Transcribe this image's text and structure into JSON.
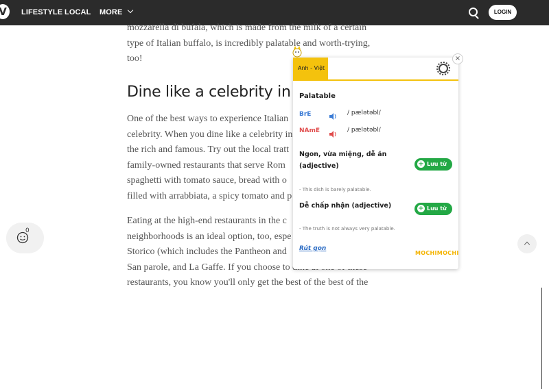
{
  "topbar": {
    "logo": "V",
    "nav": [
      "LIFESTYLE",
      "LOCAL",
      "MORE"
    ],
    "login_label": "LOGIN",
    "icons": {
      "search": "search-icon",
      "more": "chevron-down-icon"
    }
  },
  "article": {
    "p1_lines": [
      "mozzarella di bufala, which is made from the milk of a certain",
      "type of Italian buffalo, is incredibly palatable and worth-trying,",
      "too!"
    ],
    "heading": "Dine like a celebrity in I",
    "p2_lines": [
      "One of the best ways to experience Italian",
      "celebrity. When you dine like a celebrity in",
      "the rich and famous. Try out the local tratt",
      "family-owned restaurants that serve Rom",
      "spaghetti with tomato sauce, bread with o",
      "filled with arrabbiata, a spicy tomato and p"
    ],
    "p3_lines": [
      "Eating at the high-end restaurants in the c",
      "neighborhoods is an ideal option, too, espe",
      "Storico (which includes the Pantheon and",
      "San parole, and La Gaffe. If you choose to dine at one of these",
      "restaurants, you know you'll only get the best of the best of the"
    ]
  },
  "reactions": {
    "count": "0",
    "icon": "smiley-add-icon"
  },
  "dictionary": {
    "lang_tab": "Anh - Việt",
    "word": "Palatable",
    "bre_label": "BrE",
    "bre_ipa": "/ pælətəbl/",
    "name_label": "NAmE",
    "name_ipa": "/ pælətəbl/",
    "meanings": [
      {
        "lines": [
          "Ngon, vừa miệng, dễ ăn",
          "(adjective)"
        ],
        "save": "Lưu từ",
        "example": "- This dish is barely palatable."
      },
      {
        "lines": [
          "Dễ chấp nhận (adjective)"
        ],
        "save": "Lưu từ",
        "example": "- The truth is not always very palatable."
      }
    ],
    "collapse": "Rút gọn",
    "brand": "MOCHIMOCHI",
    "close": "×",
    "accent_colors": {
      "brand_yellow": "#f4c20d",
      "save_green": "#23a845",
      "bre_blue": "#3a7bd5",
      "name_red": "#e04b4b"
    }
  }
}
